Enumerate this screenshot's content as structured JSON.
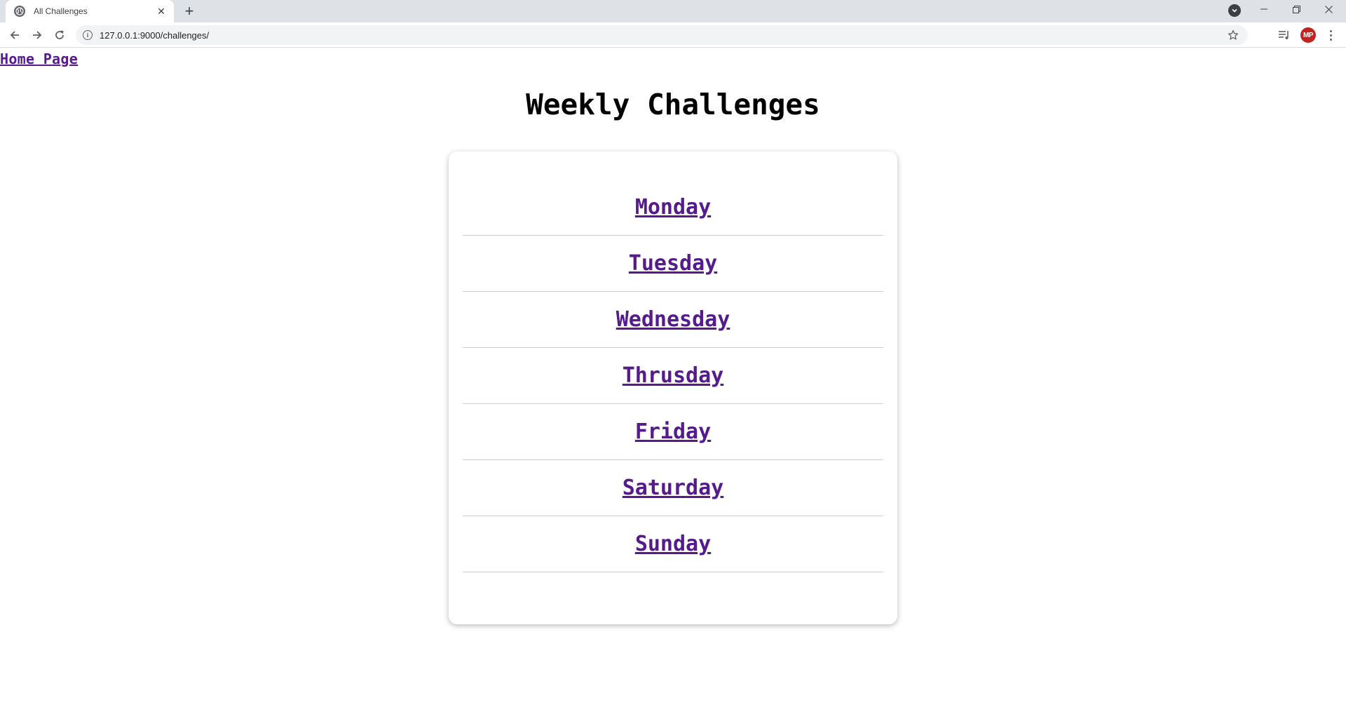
{
  "browser": {
    "tab_title": "All Challenges",
    "url": "127.0.0.1:9000/challenges/",
    "avatar_initials": "MP",
    "new_tab_glyph": "+",
    "close_glyph": "✕"
  },
  "page": {
    "home_link": "Home Page",
    "title": "Weekly Challenges",
    "days": [
      {
        "label": "Monday"
      },
      {
        "label": "Tuesday"
      },
      {
        "label": "Wednesday"
      },
      {
        "label": "Thrusday"
      },
      {
        "label": "Friday"
      },
      {
        "label": "Saturday"
      },
      {
        "label": "Sunday"
      }
    ]
  },
  "colors": {
    "link_visited": "#551a8b",
    "avatar_bg": "#c5221f",
    "chrome_bg": "#dee1e6"
  },
  "icons": [
    "globe-icon",
    "close-icon",
    "plus-icon",
    "tab-search-icon",
    "minimize-icon",
    "restore-icon",
    "window-close-icon",
    "back-arrow-icon",
    "forward-arrow-icon",
    "reload-icon",
    "info-icon",
    "star-icon",
    "media-icon",
    "menu-icon"
  ]
}
